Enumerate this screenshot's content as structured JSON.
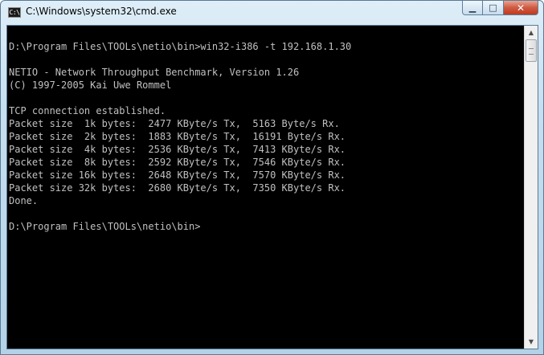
{
  "window": {
    "title": "C:\\Windows\\system32\\cmd.exe",
    "icon_text": "C:\\"
  },
  "caption": {
    "minimize_glyph": "▁",
    "maximize_glyph": "□",
    "close_glyph": "✕"
  },
  "scrollbar": {
    "up_glyph": "▲",
    "down_glyph": "▼",
    "position_fraction": 0.0
  },
  "terminal": {
    "lines": [
      "",
      "D:\\Program Files\\TOOLs\\netio\\bin>win32-i386 -t 192.168.1.30",
      "",
      "NETIO - Network Throughput Benchmark, Version 1.26",
      "(C) 1997-2005 Kai Uwe Rommel",
      "",
      "TCP connection established.",
      "Packet size  1k bytes:  2477 KByte/s Tx,  5163 Byte/s Rx.",
      "Packet size  2k bytes:  1883 KByte/s Tx,  16191 Byte/s Rx.",
      "Packet size  4k bytes:  2536 KByte/s Tx,  7413 KByte/s Rx.",
      "Packet size  8k bytes:  2592 KByte/s Tx,  7546 KByte/s Rx.",
      "Packet size 16k bytes:  2648 KByte/s Tx,  7570 KByte/s Rx.",
      "Packet size 32k bytes:  2680 KByte/s Tx,  7350 KByte/s Rx.",
      "Done.",
      "",
      "D:\\Program Files\\TOOLs\\netio\\bin>"
    ]
  },
  "colors": {
    "terminal_bg": "#000000",
    "terminal_fg": "#c0c0c0",
    "close_button": "#c0391f"
  }
}
